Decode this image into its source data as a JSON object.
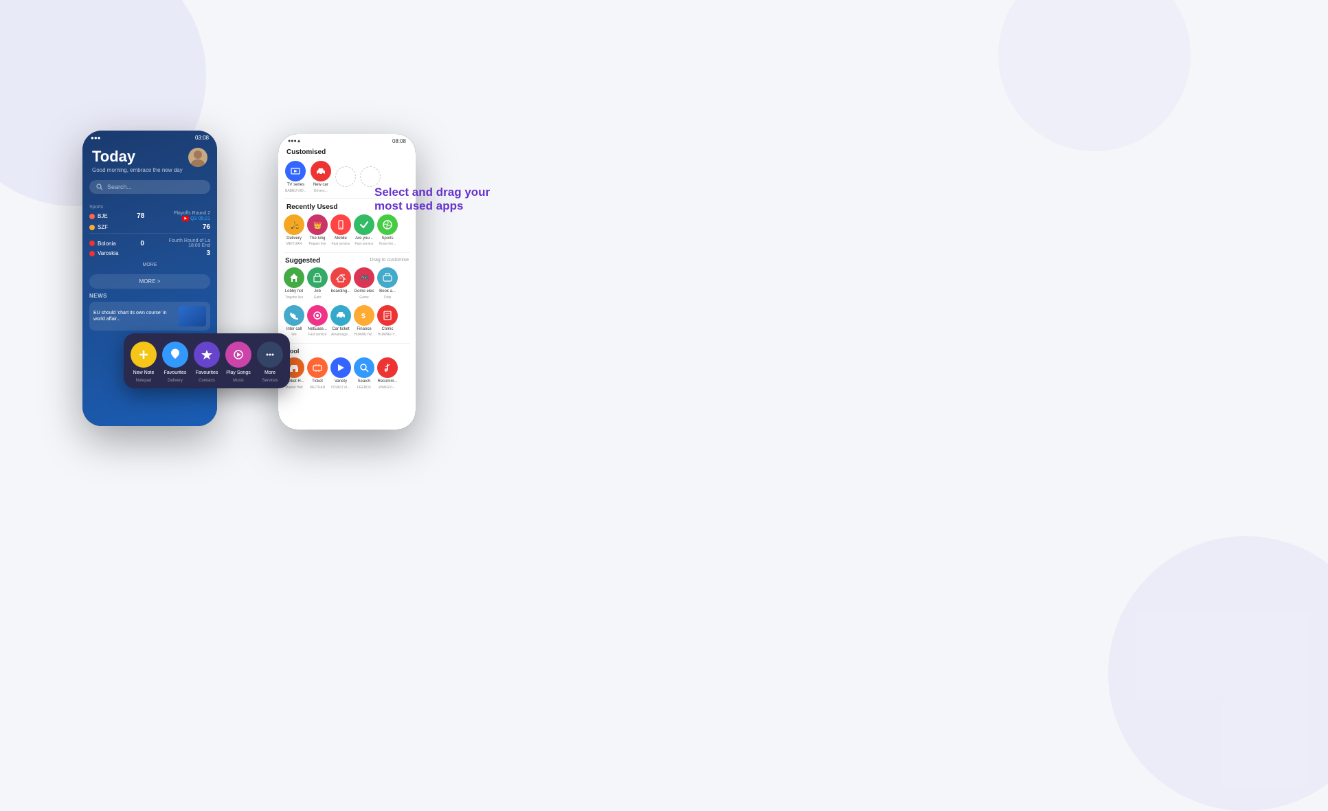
{
  "background": {
    "color": "#f5f6fa"
  },
  "phone1": {
    "status_bar": {
      "signal": "●●●",
      "time": "03:08",
      "battery": "█"
    },
    "today_title": "Today",
    "today_subtitle": "Good morning, embrace the new day",
    "search_placeholder": "Search...",
    "quick_actions": [
      {
        "icon": "+",
        "color": "#f5c518",
        "label": "New Note",
        "sublabel": "Notepad"
      },
      {
        "icon": "♥",
        "color": "#3399ff",
        "label": "Favourites",
        "sublabel": "Delivery"
      },
      {
        "icon": "★",
        "color": "#6644cc",
        "label": "Favourites",
        "sublabel": "Contacts"
      },
      {
        "icon": "♪",
        "color": "#cc44aa",
        "label": "Play Songs",
        "sublabel": "Music"
      },
      {
        "icon": "•••",
        "color": "#334466",
        "label": "More",
        "sublabel": "Services"
      }
    ],
    "sports": [
      {
        "team1": "BJE",
        "team2": "SZF",
        "score1": "78",
        "score2": "76",
        "info": "Playoffs Round 2",
        "sub": "Q3 05:21",
        "yt": true
      },
      {
        "team1": "Bolonia",
        "team2": "Varcekia",
        "score1": "0",
        "score2": "3",
        "info": "Fourth Round of La",
        "sub": "18:00 End"
      }
    ],
    "more_text": "MORE",
    "more_arrow_text": "MORE >",
    "news_label": "NEWS",
    "news_item": "EU should 'chart its own course' in world affair..."
  },
  "phone2": {
    "status_bar": {
      "signal": "●●●",
      "time": "08:08",
      "battery": "█"
    },
    "customised_label": "Customised",
    "customised_apps": [
      {
        "name": "TV series",
        "sub": "BABBU VID...",
        "color": "#3366ff",
        "icon": "▶"
      },
      {
        "name": "New car",
        "sub": "Drivers...",
        "color": "#ee3333",
        "icon": "🚗"
      }
    ],
    "recently_used_label": "Recently Usesd",
    "recently_apps": [
      {
        "name": "Delivery",
        "sub": "MEITUAN",
        "color": "#f5a623",
        "icon": "🛵"
      },
      {
        "name": "The king",
        "sub": "Pepper live",
        "color": "#cc3366",
        "icon": "👑"
      },
      {
        "name": "Mobile",
        "sub": "Fast service",
        "color": "#ff4444",
        "icon": "📱"
      },
      {
        "name": "Are you...",
        "sub": "Fast service",
        "color": "#33bb66",
        "icon": "✓"
      },
      {
        "name": "Sports",
        "sub": "Know the...",
        "color": "#44cc44",
        "icon": "⚽"
      }
    ],
    "suggested_label": "Suggested",
    "drag_hint": "Drag to customise",
    "suggested_row1": [
      {
        "name": "Lobby hot",
        "sub": "Tingshe live",
        "color": "#44aa44",
        "icon": "🏠"
      },
      {
        "name": "Job",
        "sub": "Gato",
        "color": "#33aa66",
        "icon": "💼"
      },
      {
        "name": "boarding...",
        "sub": "...",
        "color": "#ee4444",
        "icon": "✈"
      },
      {
        "name": "Gome elec",
        "sub": "Game",
        "color": "#dd3355",
        "icon": "🎮"
      },
      {
        "name": "Book a...",
        "sub": "Ctrip",
        "color": "#44aacc",
        "icon": "🎫"
      }
    ],
    "suggested_row2": [
      {
        "name": "Inter call",
        "sub": "We",
        "color": "#44aacc",
        "icon": "📞"
      },
      {
        "name": "NetEase...",
        "sub": "Fast service",
        "color": "#ee3388",
        "icon": "🎵"
      },
      {
        "name": "Car ticket",
        "sub": "Advantage...",
        "color": "#33aacc",
        "icon": "🚌"
      },
      {
        "name": "Finance",
        "sub": "HUAWEI W...",
        "color": "#ffaa33",
        "icon": "$"
      },
      {
        "name": "Comic",
        "sub": "HUAWEI-Y...",
        "color": "#ee3333",
        "icon": "📖"
      }
    ],
    "tool_label": "Tool",
    "tool_apps": [
      {
        "name": "Market H...",
        "sub": "Market Hall",
        "color": "#ee6622",
        "icon": "🏪"
      },
      {
        "name": "Ticket",
        "sub": "MEITUAN",
        "color": "#ff6633",
        "icon": "🎟"
      },
      {
        "name": "Variety",
        "sub": "YOUKU VL...",
        "color": "#3366ff",
        "icon": "🎬"
      },
      {
        "name": "Search",
        "sub": "FEEBOX",
        "color": "#3399ff",
        "icon": "🔍"
      },
      {
        "name": "Recomm...",
        "sub": "WANGYI-...",
        "color": "#ee3333",
        "icon": "👍"
      }
    ]
  },
  "callout": {
    "line1": "Select and drag your",
    "line2": "most used apps"
  }
}
